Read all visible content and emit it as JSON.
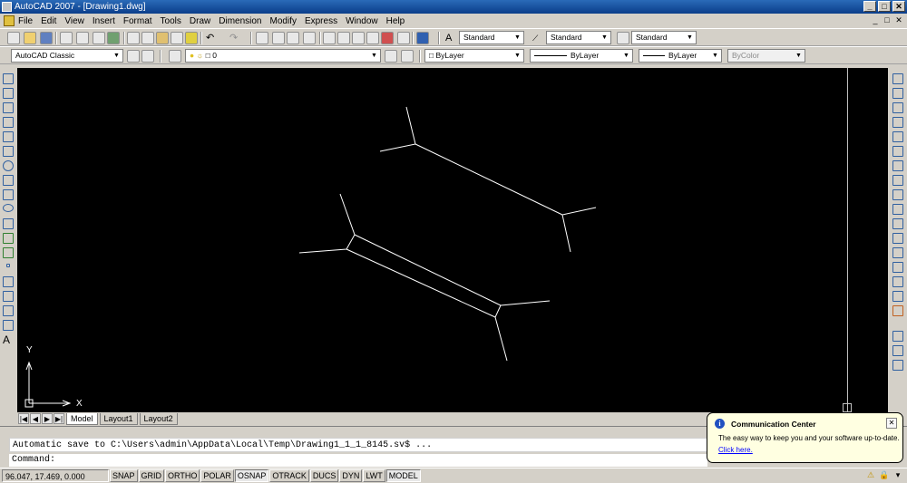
{
  "window": {
    "title": "AutoCAD 2007 - [Drawing1.dwg]",
    "controls": [
      "_",
      "□",
      "✕"
    ]
  },
  "menubar": {
    "items": [
      "File",
      "Edit",
      "View",
      "Insert",
      "Format",
      "Tools",
      "Draw",
      "Dimension",
      "Modify",
      "Express",
      "Window",
      "Help"
    ],
    "doc_controls": [
      "_",
      "□",
      "✕"
    ]
  },
  "toolbar1": {
    "text_style": "Standard",
    "dim_style": "Standard",
    "table_style": "Standard"
  },
  "toolbar2": {
    "workspace": "AutoCAD Classic",
    "layer": "0",
    "color": "ByLayer",
    "linetype": "ByLayer",
    "lineweight": "ByLayer",
    "plot_style": "ByColor"
  },
  "canvas": {
    "background": "#000000",
    "ucs_x_label": "X",
    "ucs_y_label": "Y"
  },
  "layout_tabs": {
    "tabs": [
      "Model",
      "Layout1",
      "Layout2"
    ],
    "active": "Model"
  },
  "command": {
    "history": "Automatic save to C:\\Users\\admin\\AppData\\Local\\Temp\\Drawing1_1_1_8145.sv$ ...",
    "prompt": "Command:"
  },
  "status": {
    "coordinates": "96.047, 17.469, 0.000",
    "toggles": [
      {
        "label": "SNAP",
        "on": false
      },
      {
        "label": "GRID",
        "on": false
      },
      {
        "label": "ORTHO",
        "on": false
      },
      {
        "label": "POLAR",
        "on": false
      },
      {
        "label": "OSNAP",
        "on": true
      },
      {
        "label": "OTRACK",
        "on": false
      },
      {
        "label": "DUCS",
        "on": false
      },
      {
        "label": "DYN",
        "on": false
      },
      {
        "label": "LWT",
        "on": false
      },
      {
        "label": "MODEL",
        "on": true
      }
    ]
  },
  "notification": {
    "title": "Communication Center",
    "message": "The easy way to keep you and your software up-to-date.",
    "link": "Click here.",
    "close": "✕",
    "info_icon": "i"
  },
  "icons": {
    "left_draw_tools": [
      "line-icon",
      "construction-line-icon",
      "polyline-icon",
      "polygon-icon",
      "rectangle-icon",
      "arc-icon",
      "circle-icon",
      "revision-cloud-icon",
      "spline-icon",
      "ellipse-icon",
      "ellipse-arc-icon",
      "insert-block-icon",
      "make-block-icon",
      "point-icon",
      "hatch-icon",
      "gradient-icon",
      "region-icon",
      "table-icon",
      "multiline-text-icon"
    ],
    "right_modify_tools": [
      "erase-icon",
      "copy-icon",
      "mirror-icon",
      "offset-icon",
      "array-icon",
      "move-icon",
      "rotate-icon",
      "scale-icon",
      "stretch-icon",
      "trim-icon",
      "extend-icon",
      "break-at-point-icon",
      "break-icon",
      "join-icon",
      "chamfer-icon",
      "fillet-icon",
      "explode-icon",
      "draworder-icon",
      "layer-icon",
      "properties-icon"
    ]
  }
}
